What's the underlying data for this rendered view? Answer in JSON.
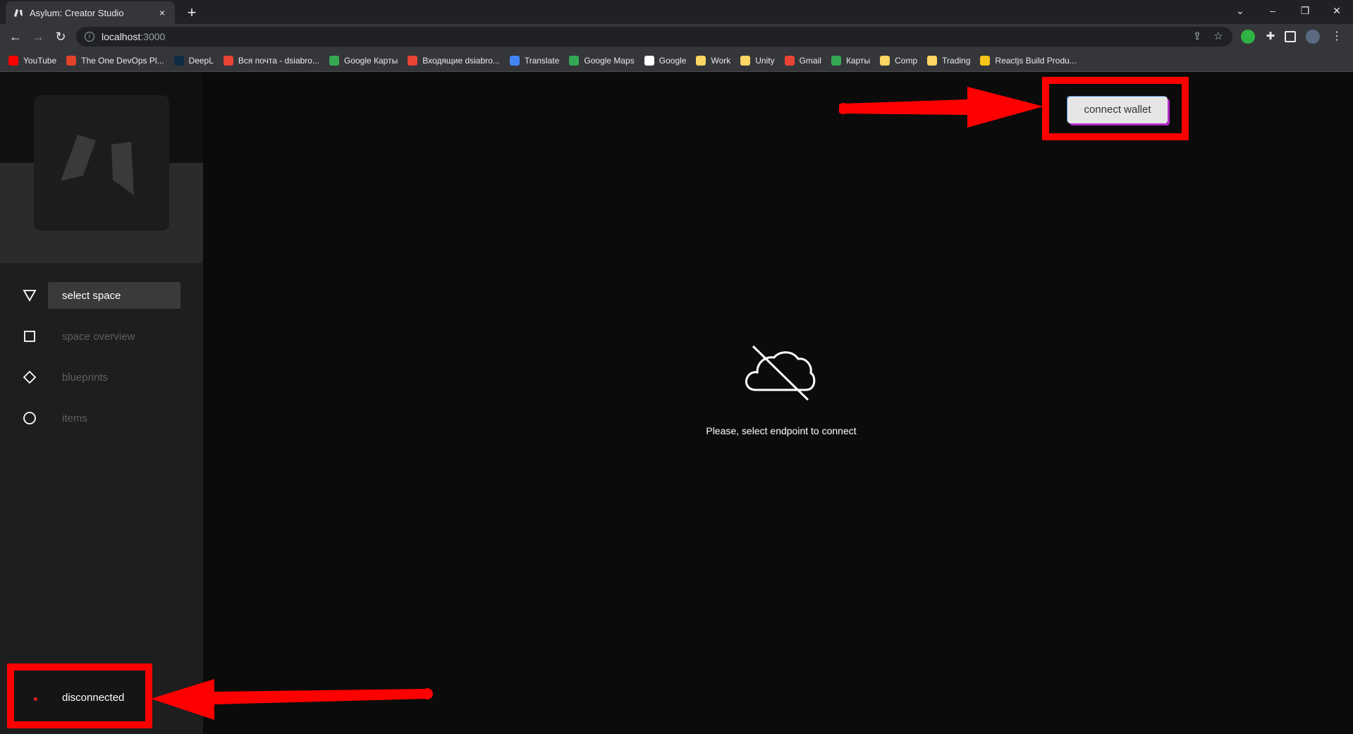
{
  "browser": {
    "tab_title": "Asylum: Creator Studio",
    "tab_close": "×",
    "new_tab": "+",
    "url_host": "localhost",
    "url_port": ":3000",
    "bookmarks": [
      {
        "label": "YouTube",
        "color": "#ff0000"
      },
      {
        "label": "The One DevOps Pl...",
        "color": "#e24329"
      },
      {
        "label": "DeepL",
        "color": "#0f2b46"
      },
      {
        "label": "Вся почта - dsiabro...",
        "color": "#ea4335"
      },
      {
        "label": "Google Карты",
        "color": "#34a853"
      },
      {
        "label": "Входящие dsiabro...",
        "color": "#ea4335"
      },
      {
        "label": "Translate",
        "color": "#4285f4"
      },
      {
        "label": "Google Maps",
        "color": "#34a853"
      },
      {
        "label": "Google",
        "color": "#ffffff"
      },
      {
        "label": "Work",
        "color": "#fdd663"
      },
      {
        "label": "Unity",
        "color": "#fdd663"
      },
      {
        "label": "Gmail",
        "color": "#ea4335"
      },
      {
        "label": "Карты",
        "color": "#34a853"
      },
      {
        "label": "Comp",
        "color": "#fdd663"
      },
      {
        "label": "Trading",
        "color": "#fdd663"
      },
      {
        "label": "Reactjs Build Produ...",
        "color": "#f5c518"
      }
    ]
  },
  "app": {
    "nav": [
      {
        "label": "select space",
        "icon": "triangle-down-icon",
        "active": true
      },
      {
        "label": "space overview",
        "icon": "square-icon",
        "active": false
      },
      {
        "label": "blueprints",
        "icon": "diamond-icon",
        "active": false
      },
      {
        "label": "items",
        "icon": "circle-icon",
        "active": false
      }
    ],
    "connect_label": "connect wallet",
    "empty_message": "Please, select endpoint to connect",
    "status_text": "disconnected"
  },
  "colors": {
    "annotation": "#ff0000",
    "status_dot": "#e02020",
    "sidebar_bg": "#1e1e1e",
    "content_bg": "#0b0b0b"
  }
}
